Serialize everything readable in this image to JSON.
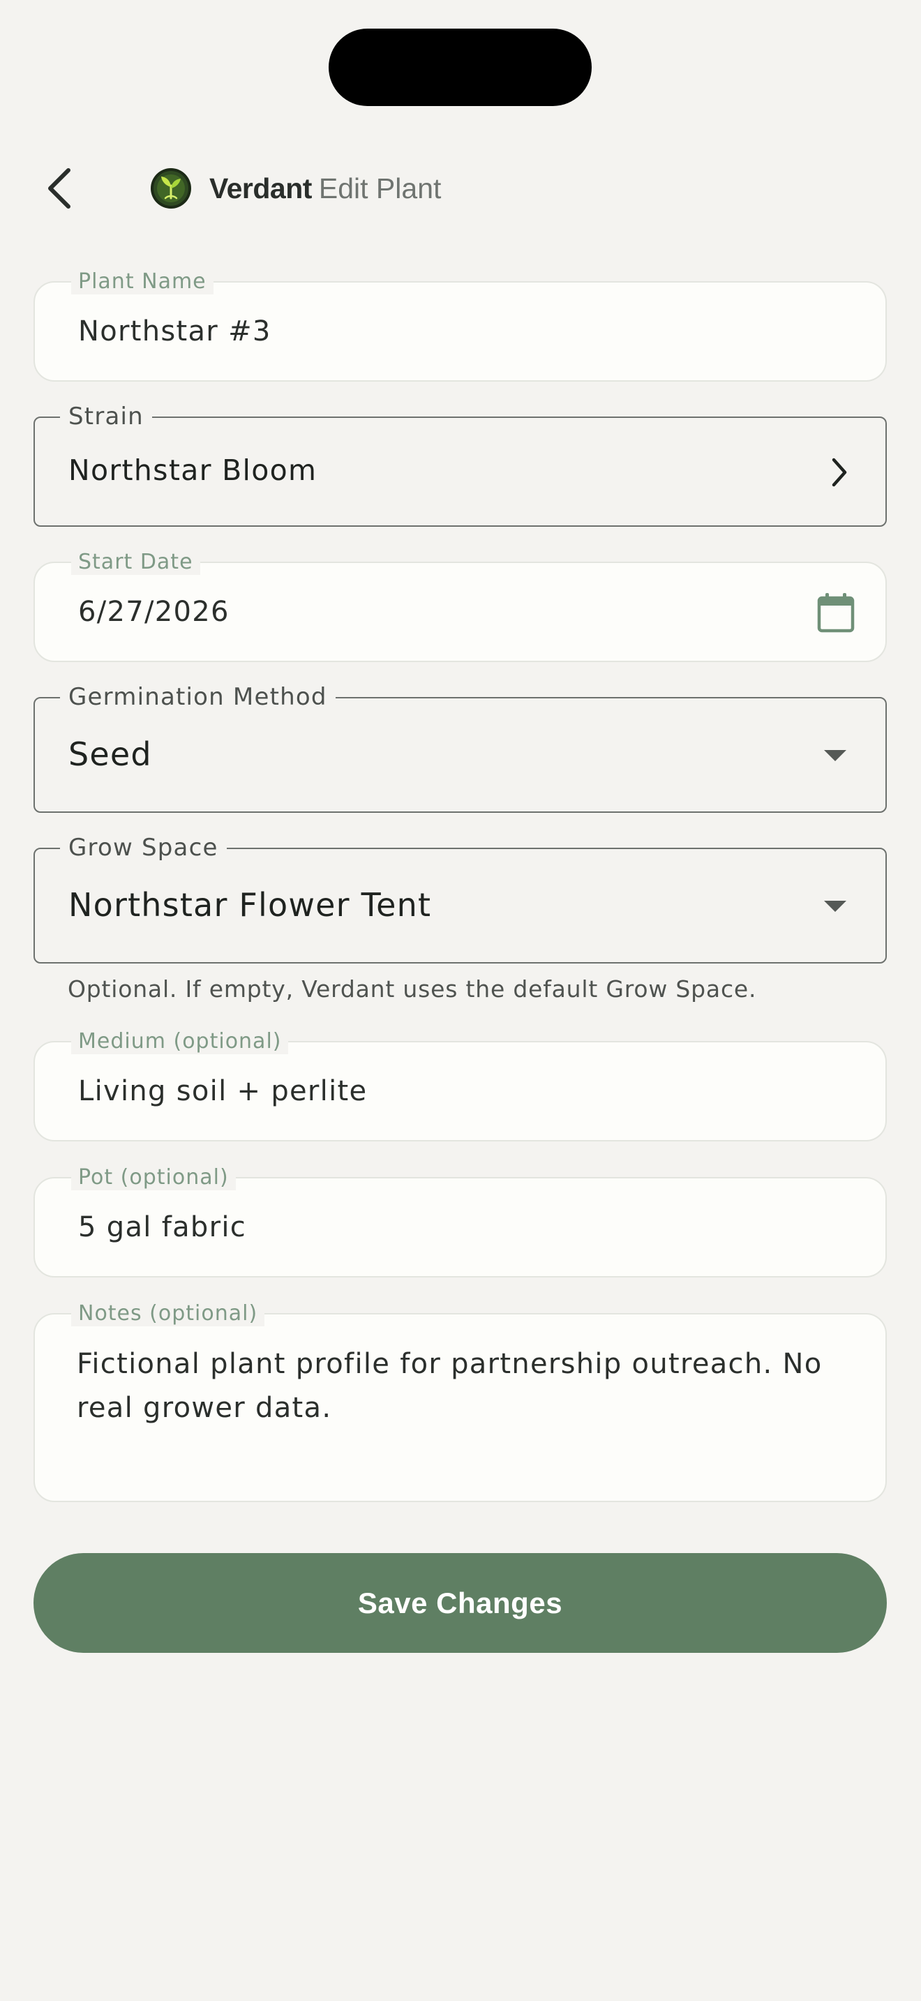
{
  "header": {
    "brand": "Verdant",
    "subtitle": "Edit Plant",
    "back_icon": "chevron-left-icon",
    "logo": "verdant-leaf-logo"
  },
  "form": {
    "plant_name": {
      "label": "Plant Name",
      "value": "Northstar #3"
    },
    "strain": {
      "label": "Strain",
      "value": "Northstar Bloom",
      "icon": "chevron-right-icon"
    },
    "start_date": {
      "label": "Start Date",
      "value": "6/27/2026",
      "icon": "calendar-icon"
    },
    "germination_method": {
      "label": "Germination Method",
      "value": "Seed",
      "icon": "dropdown-arrow-icon"
    },
    "grow_space": {
      "label": "Grow Space",
      "value": "Northstar Flower Tent",
      "icon": "dropdown-arrow-icon",
      "helper": "Optional. If empty, Verdant uses the default Grow Space."
    },
    "medium": {
      "label": "Medium (optional)",
      "value": "Living soil + perlite"
    },
    "pot": {
      "label": "Pot (optional)",
      "value": "5 gal fabric"
    },
    "notes": {
      "label": "Notes (optional)",
      "value": "Fictional plant profile for partnership outreach. No real grower data."
    }
  },
  "actions": {
    "save_label": "Save Changes"
  },
  "colors": {
    "background": "#f4f3f0",
    "accent": "#5f7f63",
    "field_label": "#7f9a86",
    "field_fill": "#fdfdfa"
  }
}
